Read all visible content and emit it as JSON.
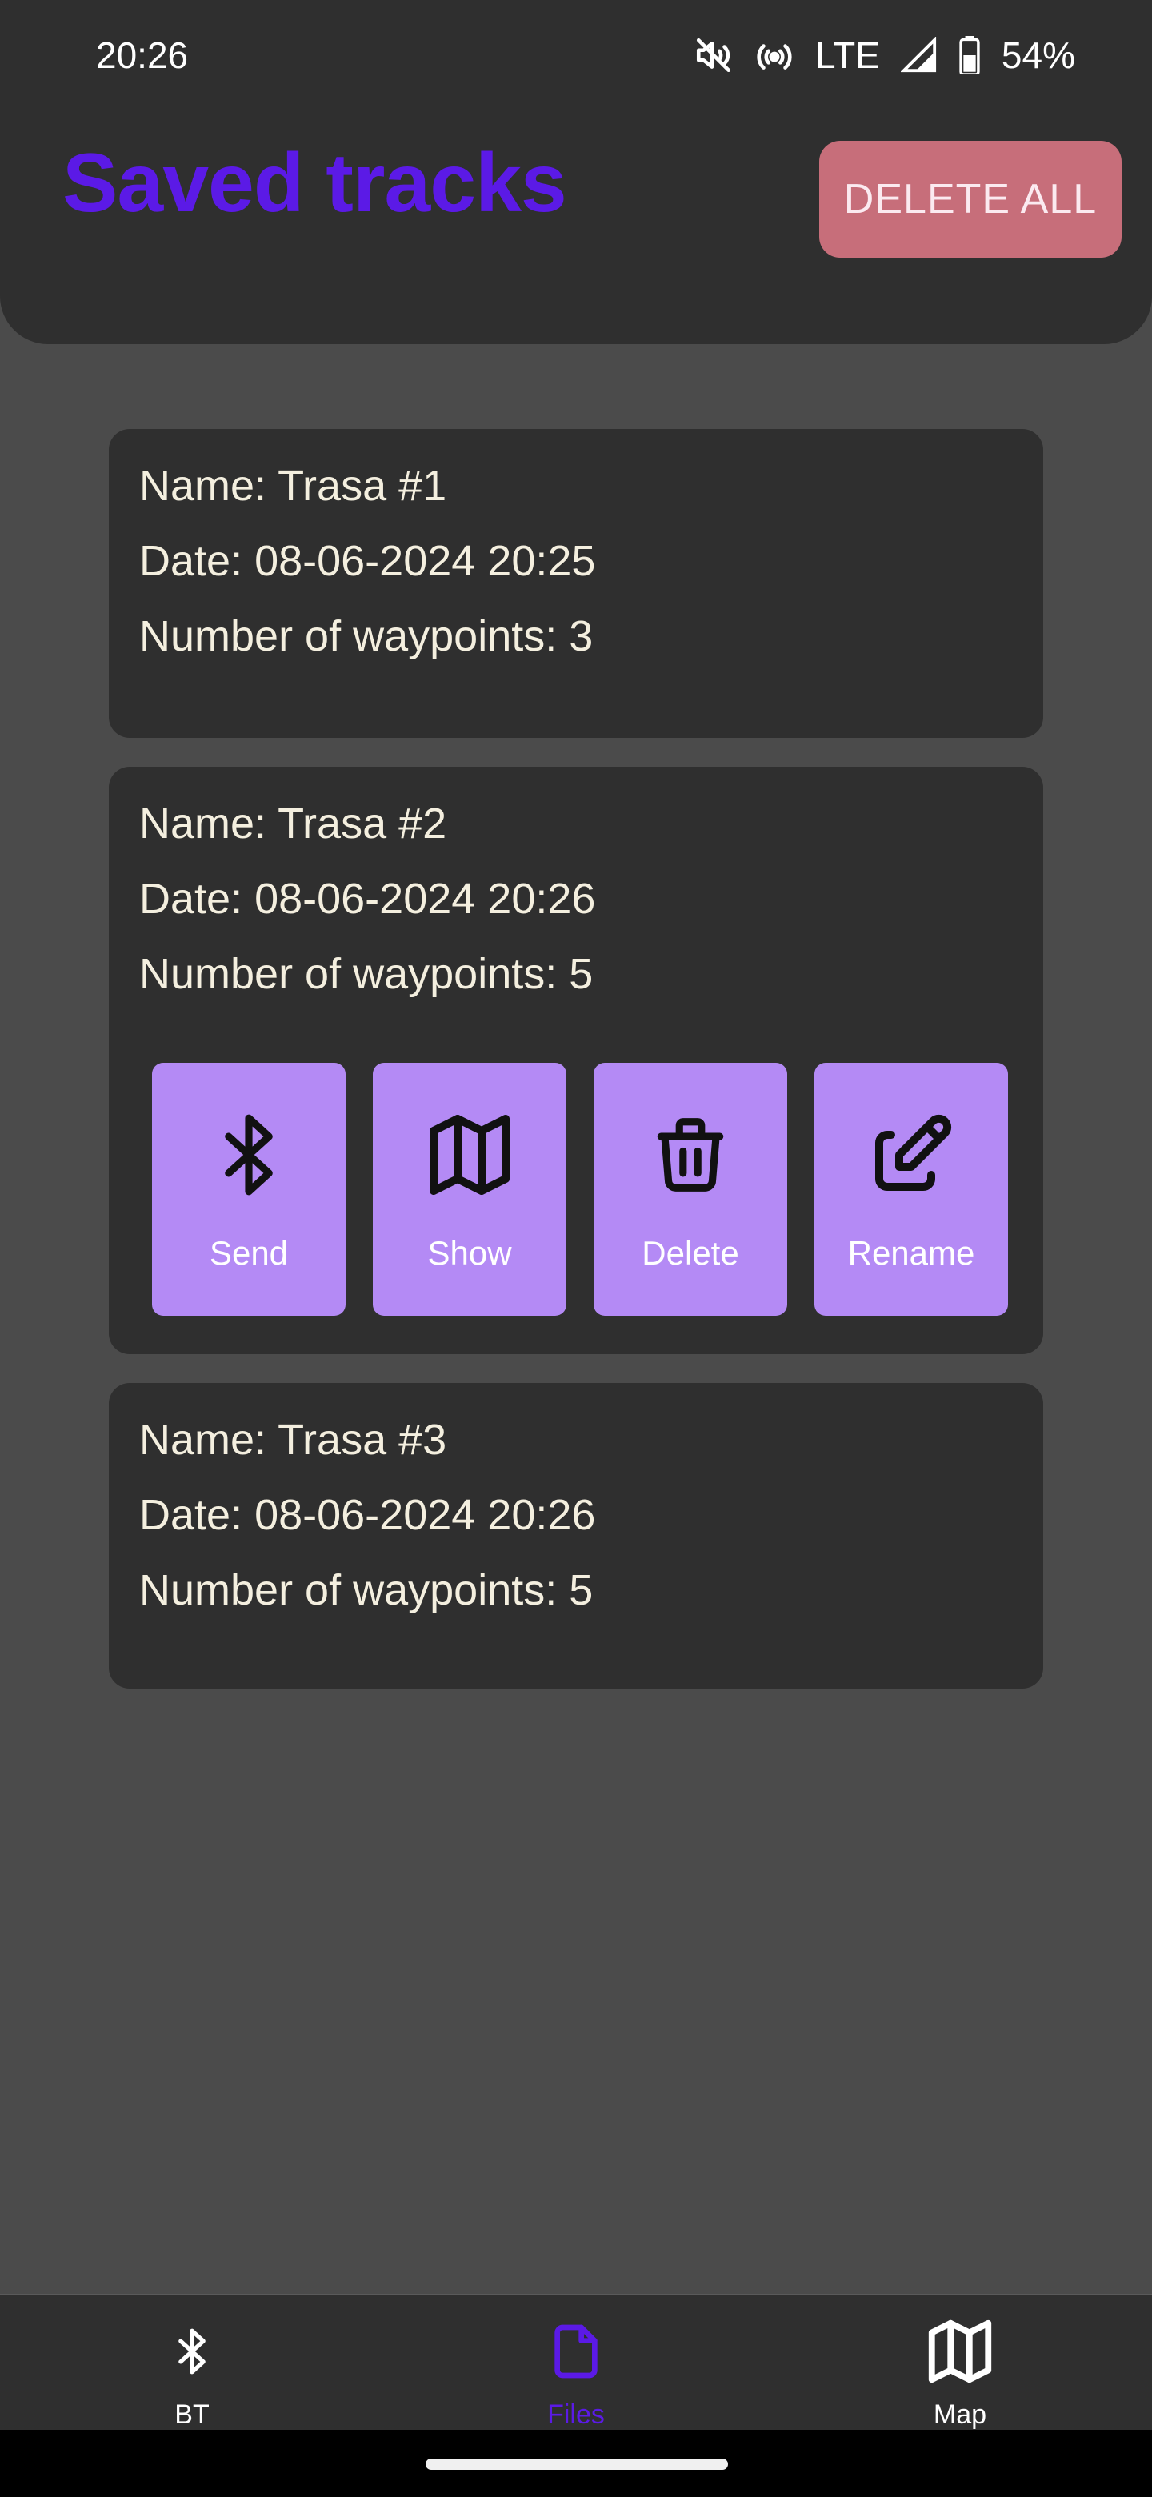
{
  "status_bar": {
    "time": "20:26",
    "network": "LTE",
    "battery": "54%",
    "icons": [
      "mute-icon",
      "hotspot-icon",
      "signal-icon",
      "battery-icon"
    ]
  },
  "header": {
    "title": "Saved tracks",
    "delete_all_label": "DELETE ALL"
  },
  "tracks": [
    {
      "name": "Name: Trasa #1",
      "date": "Date: 08-06-2024 20:25",
      "waypoints": "Number of waypoints: 3",
      "expanded": false
    },
    {
      "name": "Name: Trasa #2",
      "date": "Date: 08-06-2024 20:26",
      "waypoints": "Number of waypoints: 5",
      "expanded": true,
      "actions": [
        {
          "label": "Send",
          "icon": "bluetooth-icon"
        },
        {
          "label": "Show",
          "icon": "map-icon"
        },
        {
          "label": "Delete",
          "icon": "trash-icon"
        },
        {
          "label": "Rename",
          "icon": "edit-icon"
        }
      ]
    },
    {
      "name": "Name: Trasa #3",
      "date": "Date: 08-06-2024 20:26",
      "waypoints": "Number of waypoints: 5",
      "expanded": false
    }
  ],
  "bottom_nav": {
    "items": [
      {
        "label": "BT",
        "icon": "bluetooth-icon",
        "active": false
      },
      {
        "label": "Files",
        "icon": "file-icon",
        "active": true
      },
      {
        "label": "Map",
        "icon": "map-icon",
        "active": false
      }
    ]
  },
  "colors": {
    "accent": "#5b1ae6",
    "action_button": "#b48af5",
    "delete_all": "#c76e7a",
    "card": "#2f2f2f",
    "background": "#4b4b4b"
  }
}
